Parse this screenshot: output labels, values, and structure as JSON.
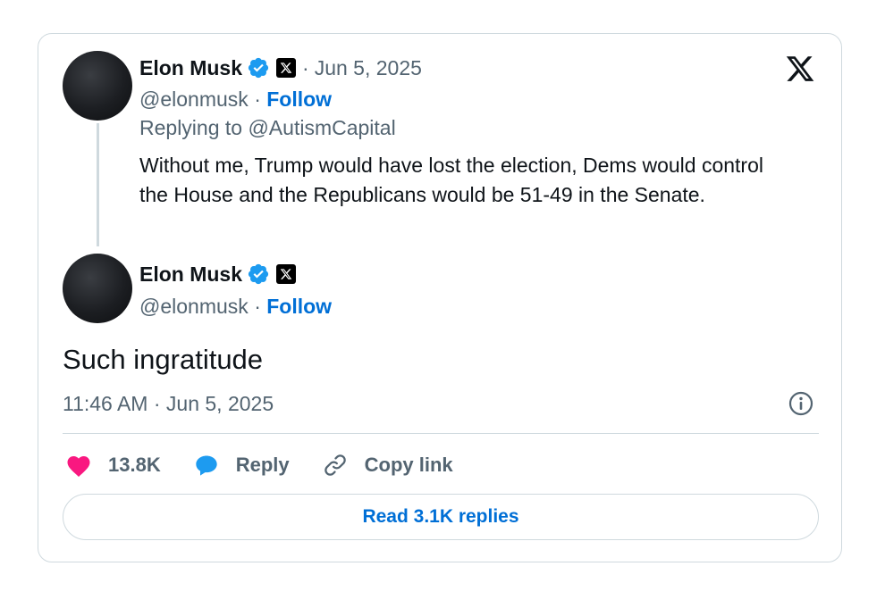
{
  "quoted_tweet": {
    "author_name": "Elon Musk",
    "handle": "@elonmusk",
    "separator": "·",
    "follow_label": "Follow",
    "date": "Jun 5, 2025",
    "replying_to": "Replying to @AutismCapital",
    "text": "Without me, Trump would have lost the election, Dems would control the House and the Republicans would be 51-49 in the Senate."
  },
  "main_tweet": {
    "author_name": "Elon Musk",
    "handle": "@elonmusk",
    "separator": "·",
    "follow_label": "Follow",
    "text": "Such ingratitude",
    "timestamp": "11:46 AM · Jun 5, 2025"
  },
  "actions": {
    "like_count": "13.8K",
    "reply_label": "Reply",
    "copy_link_label": "Copy link"
  },
  "read_replies_label": "Read 3.1K replies",
  "icons": {
    "brand": "x-logo-icon",
    "verified": "verified-badge-icon",
    "affiliate": "x-affiliate-badge-icon",
    "info": "info-icon",
    "like": "heart-icon",
    "reply": "speech-bubble-icon",
    "copy": "link-icon"
  },
  "colors": {
    "follow": "#006fd6",
    "verified": "#1d9bf0",
    "like": "#f91880",
    "reply": "#1d9bf0",
    "muted": "#536471",
    "border": "#cfd9de"
  }
}
